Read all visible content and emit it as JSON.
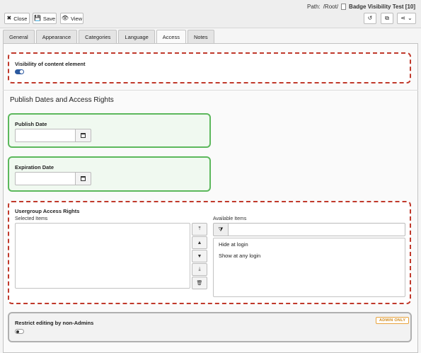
{
  "header": {
    "path_label": "Path:",
    "path_value": "/Root/",
    "page_title": "Badge Visibility Test [10]",
    "buttons": {
      "close": "Close",
      "save": "Save",
      "view": "View"
    }
  },
  "tabs": [
    "General",
    "Appearance",
    "Categories",
    "Language",
    "Access",
    "Notes"
  ],
  "active_tab": "Access",
  "visibility": {
    "label": "Visibility of content element",
    "enabled": true
  },
  "publish_section": {
    "title": "Publish Dates and Access Rights",
    "publish_date_label": "Publish Date",
    "publish_date_value": "",
    "expiration_date_label": "Expiration Date",
    "expiration_date_value": ""
  },
  "usergroup": {
    "label": "Usergroup Access Rights",
    "selected_label": "Selected Items",
    "selected_items": [],
    "available_label": "Available Items",
    "filter_value": "",
    "available_items": [
      "Hide at login",
      "Show at any login"
    ]
  },
  "restrict": {
    "label": "Restrict editing by non-Admins",
    "badge": "ADMIN ONLY",
    "enabled": false
  },
  "colors": {
    "error_border": "#c0392b",
    "valid_border": "#5cb85c",
    "toggle_on": "#2c5aa0",
    "badge": "#e8a33d"
  }
}
